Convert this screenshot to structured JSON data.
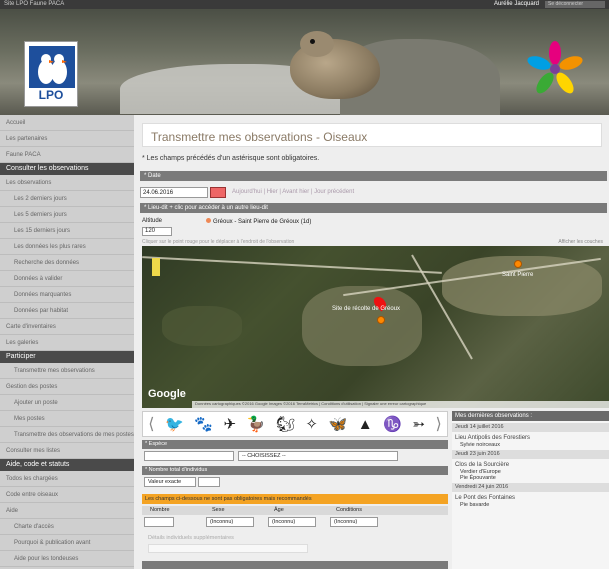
{
  "topbar": {
    "left": "Site LPO Faune PACA",
    "user": "Aurélie Jacquard",
    "logout": "Se déconnecter"
  },
  "banner": {
    "logo_text": "LPO"
  },
  "sidebar": {
    "items": [
      {
        "label": "Accueil",
        "type": "item"
      },
      {
        "label": "Les partenaires",
        "type": "item"
      },
      {
        "label": "Faune PACA",
        "type": "item"
      },
      {
        "label": "Consulter les observations",
        "type": "head"
      },
      {
        "label": "Les observations",
        "type": "item"
      },
      {
        "label": "Les 2 derniers jours",
        "type": "sub"
      },
      {
        "label": "Les 5 derniers jours",
        "type": "sub"
      },
      {
        "label": "Les 15 derniers jours",
        "type": "sub"
      },
      {
        "label": "Les données les plus rares",
        "type": "sub"
      },
      {
        "label": "Recherche des données",
        "type": "sub"
      },
      {
        "label": "Données à valider",
        "type": "sub"
      },
      {
        "label": "Données marquantes",
        "type": "sub"
      },
      {
        "label": "Données par habitat",
        "type": "sub"
      },
      {
        "label": "Carte d'inventaires",
        "type": "item"
      },
      {
        "label": "Les galeries",
        "type": "item"
      },
      {
        "label": "Participer",
        "type": "head"
      },
      {
        "label": "Transmettre mes observations",
        "type": "sub"
      },
      {
        "label": "Gestion des postes",
        "type": "item"
      },
      {
        "label": "Ajouter un poste",
        "type": "sub"
      },
      {
        "label": "Mes postes",
        "type": "sub"
      },
      {
        "label": "Transmettre des observations de mes postes",
        "type": "sub"
      },
      {
        "label": "Consulter mes listes",
        "type": "item"
      },
      {
        "label": "Aide, code et statuts",
        "type": "head"
      },
      {
        "label": "Todos les chargées",
        "type": "item"
      },
      {
        "label": "Code entre oiseaux",
        "type": "item"
      },
      {
        "label": "Aide",
        "type": "item"
      },
      {
        "label": "Charte d'accès",
        "type": "sub"
      },
      {
        "label": "Pourquoi & publication avant",
        "type": "sub"
      },
      {
        "label": "Aide pour les tondeuses",
        "type": "sub"
      }
    ]
  },
  "main": {
    "title": "Transmettre mes observations - Oiseaux",
    "required_note": "* Les champs précédés d'un astérisque sont obligatoires.",
    "date_section": "* Date",
    "date_value": "24.06.2016",
    "date_links": "Aujourd'hui | Hier | Avant hier | Jour précédent",
    "place_section": "* Lieu-dit + clic pour accéder à un autre lieu-dit",
    "altitude_label": "Altitude",
    "altitude_value": "120",
    "place_name": "Gréoux - Saint Pierre de Gréoux (1d)",
    "map_hint": "Cliquer sur le point rouge pour le déplacer à l'endroit de l'observation",
    "map_hint_right": "Afficher les couches",
    "map": {
      "label_center": "Site de récolte de Gréoux",
      "label_right": "Saint Pierre",
      "google": "Google",
      "attribution": "Données cartographiques ©2016 Google Images ©2016 TerraMetrics | Conditions d'utilisation | Signaler une erreur cartographique"
    },
    "taxon_arrows": {
      "left": "⟨",
      "right": "⟩"
    },
    "taxon_glyphs": [
      "🐦",
      "🐾",
      "✈",
      "🦆",
      "🐿",
      "✧",
      "🦋",
      "▲",
      "♑",
      "➳"
    ],
    "espece_section": "* Espèce",
    "espece_select": "-- CHOISISSEZ --",
    "nombre_section": "* Nombre total d'individus",
    "nombre_select": "Valeur exacte",
    "orange_section": "Les champs ci-dessous ne sont pas obligatoires mais recommandés",
    "columns": [
      "Nombre",
      "Sexe",
      "Âge",
      "Conditions"
    ],
    "row": {
      "sexe": "(Inconnu)",
      "age": "(Inconnu)",
      "cond": "(Inconnu)"
    },
    "faded_text": "Détails individuels supplémentaires"
  },
  "recent": {
    "title": "Mes dernières observations :",
    "entries": [
      {
        "date": "Jeudi 14 juillet 2016",
        "place": "Lieu Antipolis des Forestiers",
        "species": [
          {
            "name": "Sylvie noirceaux"
          }
        ]
      },
      {
        "date": "Jeudi 23 juin 2016",
        "place": "Clos de la Sourcière",
        "species": [
          {
            "name": "Verdier d'Europe"
          },
          {
            "name": "Pie Épouvante"
          }
        ]
      },
      {
        "date": "Vendredi 24 juin 2016",
        "place": "Le Pont des Fontaines",
        "species": [
          {
            "name": "Pie bavarde"
          }
        ]
      }
    ]
  },
  "colors": {
    "accent_orange": "#f4a323",
    "header_gray": "#7a7a7a",
    "sidebar_head": "#4a4a4a",
    "pin_red": "#e11"
  }
}
